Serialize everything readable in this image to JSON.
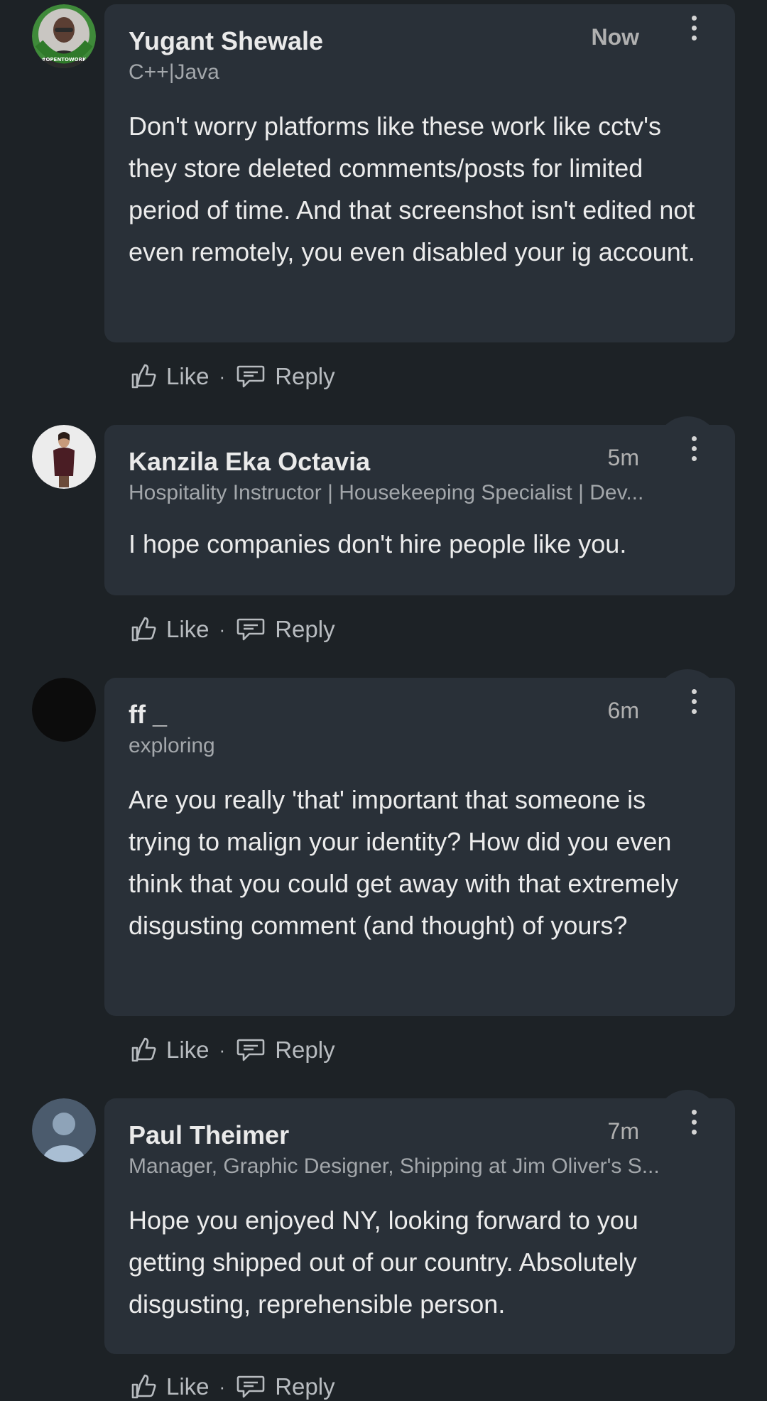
{
  "comments": [
    {
      "name": "Yugant Shewale",
      "headline": "C++|Java",
      "time": "Now",
      "text": "Don't worry platforms like these work like cctv's they store deleted comments/posts for limited period of time. And that screenshot isn't edited not even remotely, you even disabled your ig account.",
      "like_label": "Like",
      "reply_label": "Reply",
      "avatar_badge": "#OPENTOWORK"
    },
    {
      "name": "Kanzila Eka Octavia",
      "headline": "Hospitality Instructor | Housekeeping Specialist | Dev...",
      "time": "5m",
      "text": "I hope companies don't hire people like you.",
      "like_label": "Like",
      "reply_label": "Reply"
    },
    {
      "name": "ff _",
      "headline": "exploring",
      "time": "6m",
      "text": "Are you really 'that' important that someone is trying to malign your identity? How did you even think that you could get away with that extremely disgusting comment (and thought) of yours?",
      "like_label": "Like",
      "reply_label": "Reply"
    },
    {
      "name": "Paul Theimer",
      "headline": "Manager, Graphic Designer, Shipping at Jim Oliver's S...",
      "time": "7m",
      "text": "Hope you enjoyed NY, looking forward to you getting shipped out of our country. Absolutely disgusting, reprehensible person.",
      "like_label": "Like",
      "reply_label": "Reply"
    }
  ],
  "colors": {
    "background": "#1d2226",
    "bubble": "#293038",
    "open_to_work_ring": "#3f8a3a"
  }
}
